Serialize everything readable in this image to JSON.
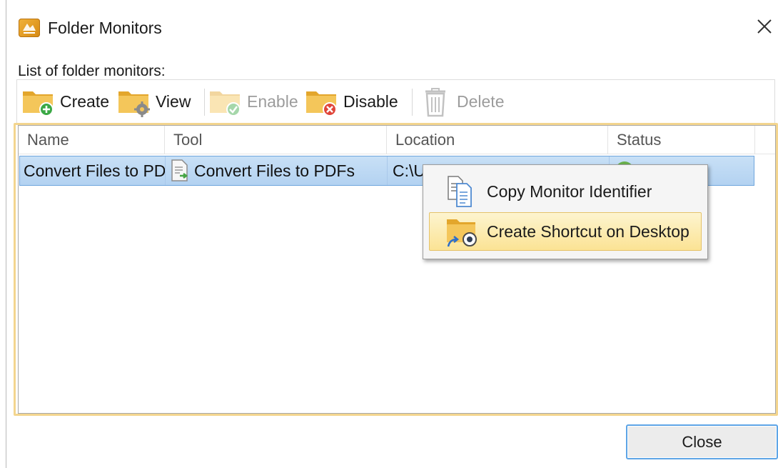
{
  "window": {
    "title": "Folder Monitors",
    "icon": "pdf-xchange-app-icon",
    "close_icon": "close-x-icon"
  },
  "list_caption": "List of folder monitors:",
  "toolbar": {
    "create": "Create",
    "view": "View",
    "enable": "Enable",
    "disable": "Disable",
    "delete": "Delete"
  },
  "table": {
    "columns": [
      "Name",
      "Tool",
      "Location",
      "Status"
    ],
    "rows": [
      {
        "name": "Convert Files to PDFs",
        "tool": "Convert Files to PDFs",
        "location": "C:\\Users\\Sam\\Desktop\\Mi",
        "status": "Enabled",
        "selected": true
      }
    ]
  },
  "context_menu": {
    "items": [
      {
        "label": "Copy Monitor Identifier",
        "icon": "copy-document-icon",
        "highlighted": false
      },
      {
        "label": "Create Shortcut on Desktop",
        "icon": "folder-shortcut-icon",
        "highlighted": true
      }
    ]
  },
  "footer": {
    "close": "Close"
  },
  "colors": {
    "folder": "#f2c04d",
    "selection": "#b8d6f3",
    "menu_highlight": "#fbe394",
    "focus_border": "#f3d58e",
    "button_focus": "#5ea5e6"
  }
}
